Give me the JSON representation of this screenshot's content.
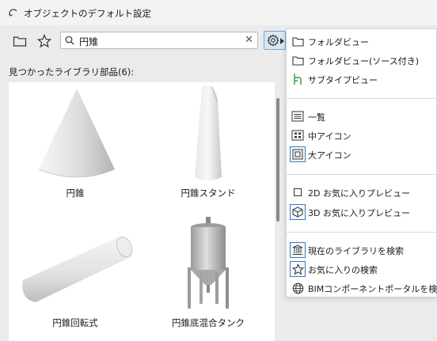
{
  "window": {
    "title": "オブジェクトのデフォルト設定"
  },
  "toolbar": {
    "search_value": "円雉"
  },
  "results": {
    "label": "見つかったライブラリ部品(6):"
  },
  "items": [
    {
      "label": "円錐"
    },
    {
      "label": "円錐スタンド"
    },
    {
      "label": "円錐回転式"
    },
    {
      "label": "円錐底混合タンク"
    }
  ],
  "menu": {
    "items": [
      {
        "label": "フォルダビュー"
      },
      {
        "label": "フォルダビュー(ソース付き)"
      },
      {
        "label": "サブタイプビュー"
      },
      {
        "label": "一覧"
      },
      {
        "label": "中アイコン"
      },
      {
        "label": "大アイコン"
      },
      {
        "label": "2D お気に入りプレビュー"
      },
      {
        "label": "3D お気に入りプレビュー"
      },
      {
        "label": "現在のライブラリを検索"
      },
      {
        "label": "お気に入りの検索"
      },
      {
        "label": "BIMコンポーネントポータルを検索"
      }
    ]
  },
  "colors": {
    "accent": "#3b78c6",
    "subtype_icon": "#2e9a4a"
  }
}
